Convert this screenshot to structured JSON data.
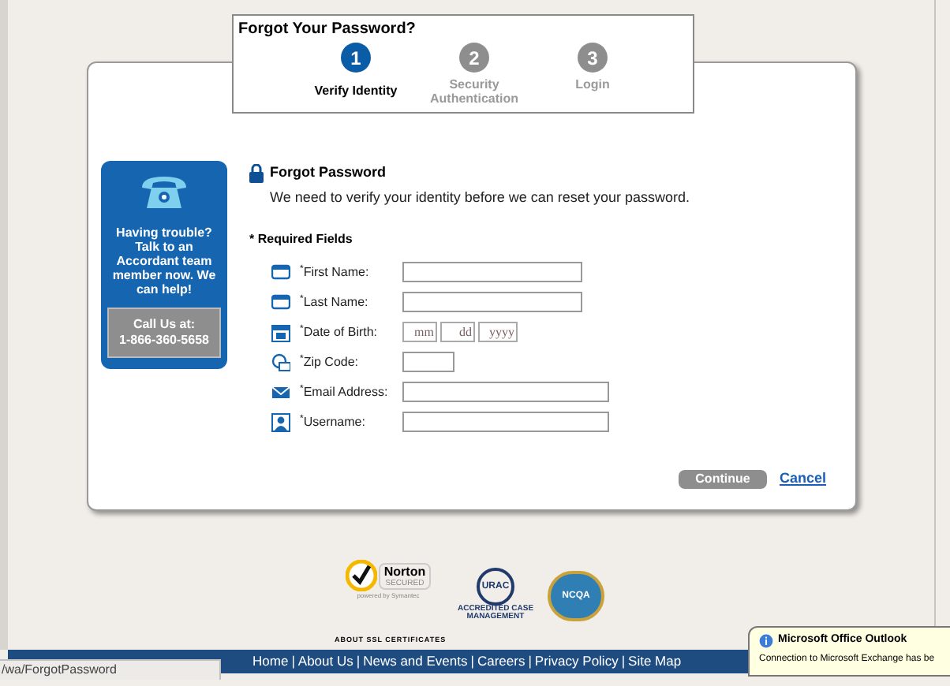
{
  "header": {
    "title": "Forgot Your Password?",
    "steps": [
      {
        "number": "1",
        "label": "Verify Identity",
        "selected": true
      },
      {
        "number": "2",
        "label": "Security Authentication",
        "selected": false
      },
      {
        "number": "3",
        "label": "Login",
        "selected": false
      }
    ]
  },
  "sidebar": {
    "message": "Having trouble? Talk to an Accordant team member now. We can help!",
    "call_label": "Call Us at:",
    "phone": "1-866-360-5658"
  },
  "form": {
    "title": "Forgot Password",
    "description": "We need to verify your identity before we can reset your password.",
    "required_note": "* Required Fields",
    "fields": [
      {
        "kind": "name",
        "label": "$^{*}$First Name:"
      },
      {
        "kind": "name",
        "label": "$^{*}$Last Name:"
      },
      {
        "kind": "date",
        "label": "$^{*}$Date of Birth:",
        "placeholders": [
          "mm",
          "dd",
          "yyyy"
        ]
      },
      {
        "kind": "zip",
        "label": "$^{*}$Zip Code:"
      },
      {
        "kind": "email",
        "label": "$^{*}$Email Address:"
      },
      {
        "kind": "username",
        "label": "$^{*}$Username:"
      }
    ],
    "continue": "Continue",
    "cancel": "Cancel"
  },
  "badges": {
    "norton": {
      "name": "Norton",
      "secured": "SECURED",
      "powered": "powered by Symantec"
    },
    "urac": {
      "name": "URAC",
      "caption": "ACCREDITED CASE MANAGEMENT"
    },
    "ncqa": {
      "name": "NCQA"
    },
    "ssl_link": "ABOUT SSL CERTIFICATES"
  },
  "footer_separator": "|",
  "footer_links": [
    "Home",
    "About Us",
    "News and Events",
    "Careers",
    "Privacy Policy",
    "Site Map"
  ],
  "status_bar": "/wa/ForgotPassword",
  "notification": {
    "title": "Microsoft Office Outlook",
    "text": "Connection to Microsoft Exchange has be"
  }
}
